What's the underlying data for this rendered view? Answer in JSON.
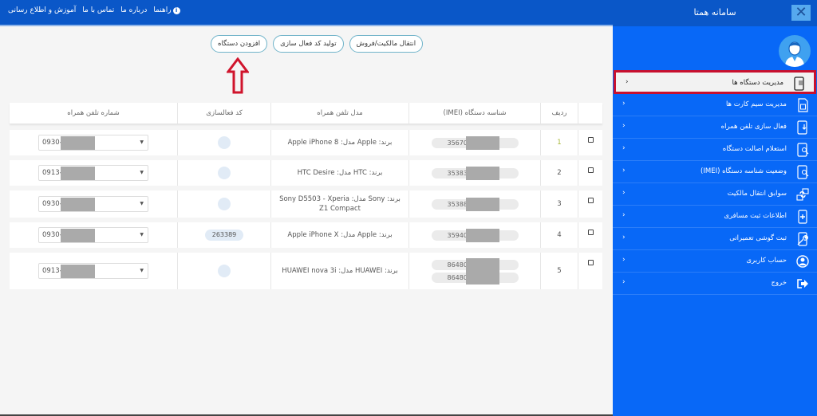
{
  "topbar": {
    "nav": [
      "راهنما",
      "درباره ما",
      "تماس با ما",
      "آموزش و اطلاع رسانی"
    ]
  },
  "sidebar": {
    "title": "سامانه همتا",
    "close_label": "✕",
    "items": [
      {
        "label": "مدیریت دستگاه ها",
        "icon": "phone-doc-icon",
        "active": true
      },
      {
        "label": "مدیریت سیم کارت ها",
        "icon": "sim-card-icon"
      },
      {
        "label": "فعال سازی تلفن همراه",
        "icon": "phone-download-icon"
      },
      {
        "label": "استعلام اصالت دستگاه",
        "icon": "phone-search-icon"
      },
      {
        "label": "وضعیت شناسه دستگاه (IMEI)",
        "icon": "phone-search-icon"
      },
      {
        "label": "سوابق انتقال مالکیت",
        "icon": "transfer-icon"
      },
      {
        "label": "اطلاعات ثبت مسافری",
        "icon": "phone-plus-icon"
      },
      {
        "label": "ثبت گوشی تعمیراتی",
        "icon": "phone-repair-icon"
      },
      {
        "label": "حساب کاربری",
        "icon": "user-icon"
      },
      {
        "label": "خروج",
        "icon": "logout-icon"
      }
    ],
    "chevron": "‹"
  },
  "actions": {
    "transfer": "انتقال مالکیت/فروش",
    "generate_code": "تولید کد فعال سازی",
    "add_device": "افزودن دستگاه"
  },
  "table": {
    "headers": {
      "index": "ردیف",
      "imei": "شناسه دستگاه (IMEI)",
      "model": "مدل تلفن همراه",
      "code": "کد فعالسازی",
      "phone": "شماره تلفن همراه"
    },
    "rows": [
      {
        "index": "1",
        "imei": [
          "356707"
        ],
        "model": "برند: Apple مدل: Apple iPhone 8",
        "code": "",
        "phone": "0930-"
      },
      {
        "index": "2",
        "imei": [
          "353833"
        ],
        "model": "برند: HTC مدل: HTC Desire",
        "code": "",
        "phone": "0913-"
      },
      {
        "index": "3",
        "imei": [
          "353888"
        ],
        "model": "برند: Sony مدل: Sony D5503 - Xperia Z1 Compact",
        "code": "",
        "phone": "0930-"
      },
      {
        "index": "4",
        "imei": [
          "359405"
        ],
        "model": "برند: Apple مدل: Apple iPhone X",
        "code": "263389",
        "phone": "0930-"
      },
      {
        "index": "5",
        "imei": [
          "864800",
          "864800"
        ],
        "model": "برند: HUAWEI مدل: HUAWEI nova 3i",
        "code": "",
        "phone": "0913-"
      }
    ]
  },
  "colors": {
    "sidebar_bg": "#0868f7",
    "topbar_bg": "#0a57c8",
    "highlight": "#c8102e"
  }
}
